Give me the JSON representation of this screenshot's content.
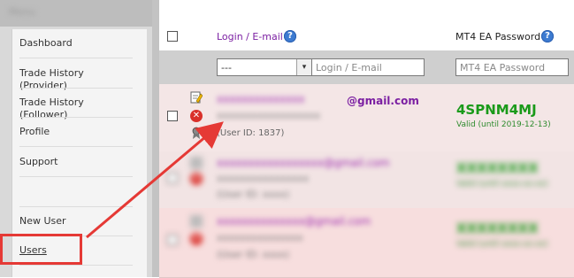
{
  "sidebar": {
    "title": "Menu",
    "items": [
      {
        "label": "Dashboard"
      },
      {
        "label": "Trade History (Provider)"
      },
      {
        "label": "Trade History (Follower)"
      },
      {
        "label": "Profile"
      },
      {
        "label": "Support"
      },
      {
        "label": "New User"
      },
      {
        "label": "Users"
      }
    ]
  },
  "table": {
    "columns": {
      "login": "Login / E-mail",
      "password": "MT4 EA Password"
    },
    "filters": {
      "login_select_value": "---",
      "login_placeholder": "Login / E-mail",
      "password_placeholder": "MT4 EA Password"
    },
    "rows": [
      {
        "email_hidden": "xxxxxxxxxxxxxx",
        "email_domain": "@gmail.com",
        "name_hidden": "xxxxxxxxxxxxxxxxxx",
        "user_id": "(User ID: 1837)",
        "password": "4SPNM4MJ",
        "valid": "Valid (until 2019-12-13)"
      },
      {
        "email_hidden": "xxxxxxxxxxxxxxxxx@gmail.com",
        "name_hidden": "xxxxxxxxxxxxxxxx",
        "user_id_hidden": "(User ID: xxxx)",
        "password_hidden": "XXXXXXXX",
        "valid_hidden": "Valid (until xxxx-xx-xx)"
      },
      {
        "email_hidden": "xxxxxxxxxxxxxx@gmail.com",
        "name_hidden": "xxxxxxxxxxxxxxx",
        "user_id_hidden": "(User ID: xxxx)",
        "password_hidden": "XXXXXXXX",
        "valid_hidden": "Valid (until xxxx-xx-xx)"
      }
    ]
  },
  "colors": {
    "accent_purple": "#7b1fa2",
    "password_green": "#1a9a1a",
    "highlight_red": "#e53935",
    "help_blue": "#3d7bd1"
  }
}
